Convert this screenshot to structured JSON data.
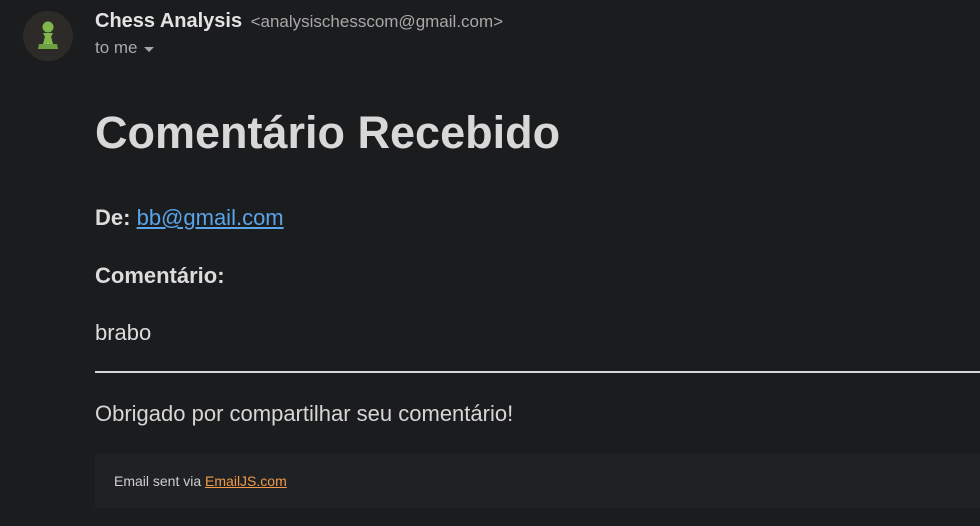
{
  "email": {
    "sender_name": "Chess Analysis",
    "sender_email": "<analysischesscom@gmail.com>",
    "recipient_label": "to me"
  },
  "body": {
    "title": "Comentário Recebido",
    "from_label": "De:",
    "from_email": "bb@gmail.com",
    "comment_label": "Comentário:",
    "comment_text": "brabo",
    "thanks_text": "Obrigado por compartilhar seu comentário!"
  },
  "footer": {
    "prefix": "Email sent via",
    "link_text": "EmailJS.com"
  },
  "colors": {
    "background": "#1b1c1e",
    "link": "#5aa4ea",
    "footer_link": "#f29a4a",
    "avatar_pawn": "#81b64c"
  },
  "icons": {
    "avatar": "chess-pawn-icon",
    "caret": "chevron-down-icon"
  }
}
